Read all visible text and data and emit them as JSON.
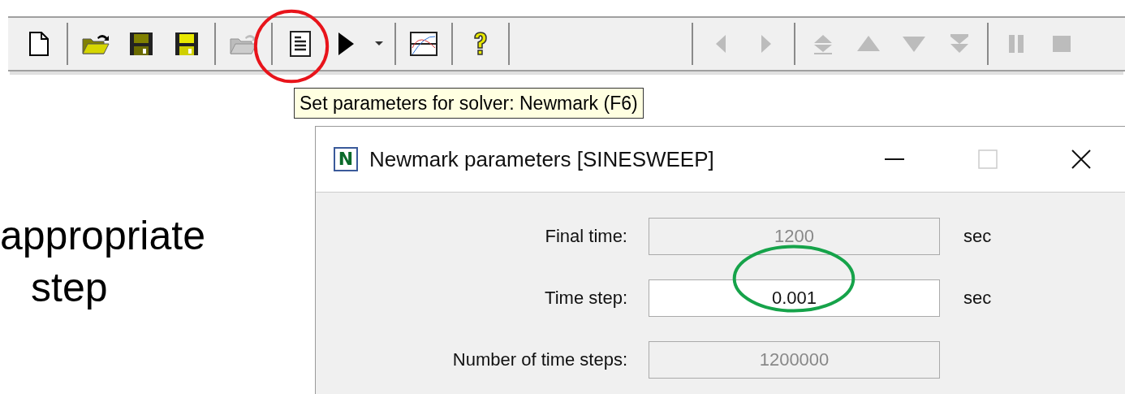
{
  "toolbar": {
    "groups": [
      [
        {
          "kind": "new",
          "disabled": false
        }
      ],
      [
        {
          "kind": "open",
          "disabled": false
        },
        {
          "kind": "save",
          "disabled": false
        },
        {
          "kind": "save-as",
          "disabled": false
        }
      ],
      [
        {
          "kind": "open",
          "disabled": true
        }
      ],
      [
        {
          "kind": "parameters",
          "disabled": false
        },
        {
          "kind": "run",
          "disabled": false
        },
        {
          "kind": "dropdown",
          "disabled": false
        }
      ],
      [
        {
          "kind": "chart",
          "disabled": false
        }
      ],
      [
        {
          "kind": "help",
          "disabled": false
        }
      ],
      [
        {
          "kind": "previous",
          "disabled": true
        },
        {
          "kind": "next",
          "disabled": true
        }
      ],
      [
        {
          "kind": "first",
          "disabled": true
        },
        {
          "kind": "up",
          "disabled": true
        },
        {
          "kind": "down",
          "disabled": true
        },
        {
          "kind": "last",
          "disabled": true
        }
      ],
      [
        {
          "kind": "pause",
          "disabled": true
        },
        {
          "kind": "stop",
          "disabled": true
        }
      ]
    ]
  },
  "slide_text": [
    "appropriate",
    "step"
  ],
  "tooltip": "Set parameters for solver: Newmark (F6)",
  "dialog": {
    "icon_letter": "N",
    "title": "Newmark parameters [SINESWEEP]",
    "maximize_disabled": true,
    "fields": [
      {
        "label": "Final time:",
        "value": "1200",
        "unit": "sec",
        "disabled": true
      },
      {
        "label": "Time step:",
        "value": "0.001",
        "unit": "sec",
        "disabled": false
      },
      {
        "label": "Number of time steps:",
        "value": "1200000",
        "disabled": true
      }
    ]
  },
  "annotations": [
    {
      "color": "#e8141b"
    },
    {
      "color": "#16a34a"
    }
  ]
}
